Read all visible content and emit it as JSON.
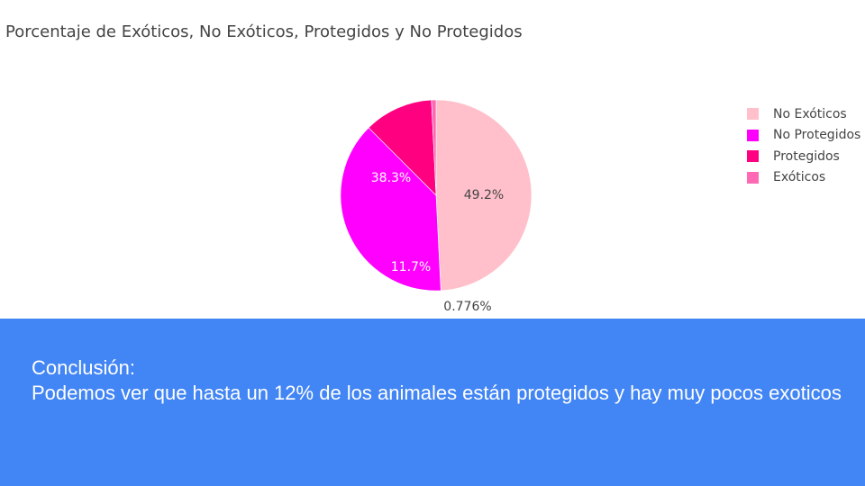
{
  "chart_data": {
    "type": "pie",
    "title": "Porcentaje de Exóticos, No Exóticos, Protegidos y No Protegidos",
    "slices": [
      {
        "label": "No Exóticos",
        "value": 49.2,
        "text": "49.2%",
        "color": "#ffc0cb"
      },
      {
        "label": "No Protegidos",
        "value": 38.3,
        "text": "38.3%",
        "color": "#ff00ff"
      },
      {
        "label": "Protegidos",
        "value": 11.7,
        "text": "11.7%",
        "color": "#ff0080"
      },
      {
        "label": "Exóticos",
        "value": 0.776,
        "text": "0.776%",
        "color": "#ff69b4"
      }
    ],
    "legend_position": "right"
  },
  "conclusion": {
    "heading": "Conclusión:",
    "body": "Podemos ver que hasta un 12% de los animales están protegidos y hay muy pocos exoticos"
  },
  "colors": {
    "panel_background": "#4285f4",
    "panel_text": "#ffffff",
    "chart_text": "#444444"
  }
}
